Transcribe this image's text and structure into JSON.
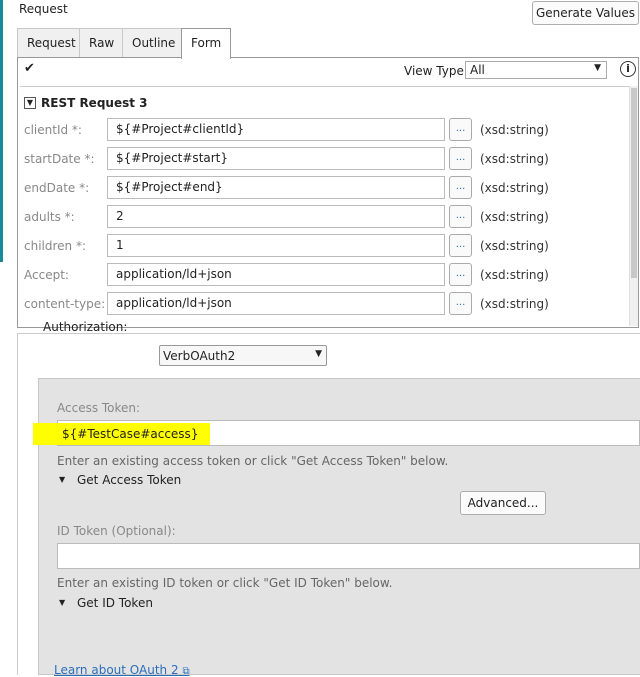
{
  "title": "Request",
  "generate_values": "Generate Values",
  "tabs": [
    "Request",
    "Raw",
    "Outline",
    "Form"
  ],
  "view_type_label": "View Type:",
  "view_type_value": "All",
  "section_title": "REST Request 3",
  "rows": [
    {
      "label": "clientId *:",
      "value": "${#Project#clientId}",
      "type": "(xsd:string)"
    },
    {
      "label": "startDate *:",
      "value": "${#Project#start}",
      "type": "(xsd:string)"
    },
    {
      "label": "endDate *:",
      "value": "${#Project#end}",
      "type": "(xsd:string)"
    },
    {
      "label": "adults *:",
      "value": "2",
      "type": "(xsd:string)"
    },
    {
      "label": "children *:",
      "value": "1",
      "type": "(xsd:string)"
    },
    {
      "label": "Accept:",
      "value": "application/ld+json",
      "type": "(xsd:string)"
    },
    {
      "label": "content-type:",
      "value": "application/ld+json",
      "type": "(xsd:string)"
    }
  ],
  "dots_label": "...",
  "auth": {
    "label": "Authorization:",
    "value": "VerbOAuth2",
    "access_token_label": "Access Token:",
    "access_token_value": "${#TestCase#access}",
    "access_help": "Enter an existing access token or click \"Get Access Token\" below.",
    "get_access_token": "Get Access Token",
    "advanced": "Advanced...",
    "id_token_label": "ID Token (Optional):",
    "id_token_value": "",
    "id_help": "Enter an existing ID token or click \"Get ID Token\" below.",
    "get_id_token": "Get ID Token",
    "learn_link": "Learn about OAuth 2"
  },
  "highlight_color": "#ffff00"
}
